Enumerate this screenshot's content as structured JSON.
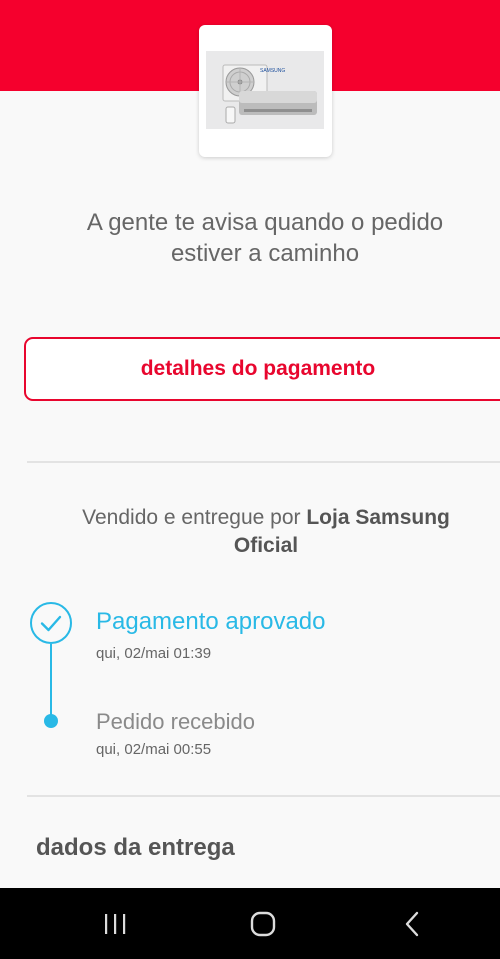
{
  "header": {
    "accent_color": "#f5002d"
  },
  "product": {
    "image_icon": "air-conditioner-product-image",
    "brand_on_image": "SAMSUNG"
  },
  "headline": {
    "line1": "A gente te avisa quando o pedido",
    "line2": "estiver a caminho"
  },
  "payment_details_button": {
    "label": "detalhes do pagamento",
    "color": "#e8062e"
  },
  "seller": {
    "prefix": "Vendido e entregue por ",
    "name_part1": "Loja Samsung",
    "name_part2": "Oficial"
  },
  "timeline": {
    "color": "#29b9e6",
    "steps": [
      {
        "title": "Pagamento aprovado",
        "time": "qui, 02/mai 01:39",
        "state": "completed",
        "icon": "check-icon"
      },
      {
        "title": "Pedido recebido",
        "time": "qui, 02/mai 00:55",
        "state": "done",
        "icon": "dot-icon"
      }
    ]
  },
  "delivery_section": {
    "title": "dados da entrega"
  },
  "system_nav": {
    "items": [
      {
        "name": "recent-apps",
        "icon": "recent-apps-icon"
      },
      {
        "name": "home",
        "icon": "home-icon"
      },
      {
        "name": "back",
        "icon": "back-icon"
      }
    ]
  }
}
